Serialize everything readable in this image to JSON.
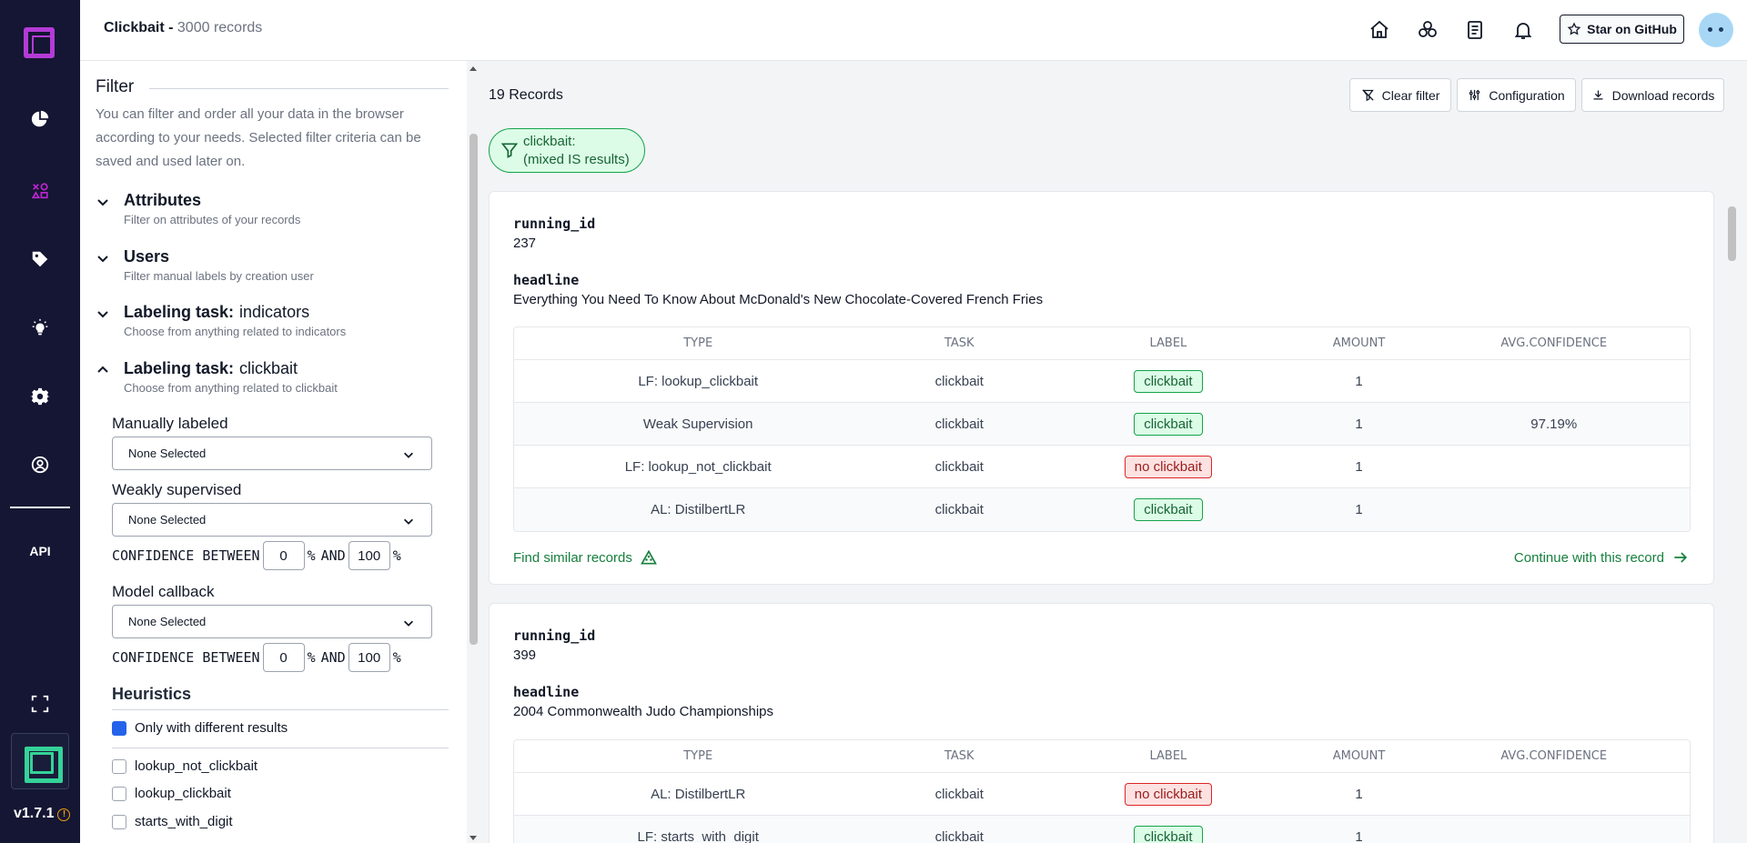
{
  "header": {
    "project": "Clickbait",
    "separator": " - ",
    "record_count": "3000 records",
    "github_label": "Star on GitHub"
  },
  "sidebar": {
    "items": [
      {
        "icon": "overview-pie-icon"
      },
      {
        "icon": "data-browser-icon",
        "active": true
      },
      {
        "icon": "labeling-tag-icon"
      },
      {
        "icon": "heuristics-bulb-icon"
      },
      {
        "icon": "settings-gear-icon"
      },
      {
        "icon": "user-admin-icon"
      }
    ],
    "api_label": "API",
    "version": "v1.7.1",
    "info_glyph": "!"
  },
  "filter": {
    "title": "Filter",
    "description": "You can filter and order all your data in the browser according to your needs. Selected filter criteria can be saved and used later on.",
    "sections": [
      {
        "title": "Attributes",
        "name": "",
        "subtitle": "Filter on attributes of your records",
        "expanded": false
      },
      {
        "title": "Users",
        "name": "",
        "subtitle": "Filter manual labels by creation user",
        "expanded": false
      },
      {
        "title": "Labeling task:",
        "name": "indicators",
        "subtitle": "Choose from anything related to indicators",
        "expanded": false
      },
      {
        "title": "Labeling task:",
        "name": "clickbait",
        "subtitle": "Choose from anything related to clickbait",
        "expanded": true
      }
    ],
    "manually_labeled": {
      "label": "Manually labeled",
      "value": "None Selected"
    },
    "weakly_supervised": {
      "label": "Weakly supervised",
      "value": "None Selected"
    },
    "confidence_1": {
      "prefix": "CONFIDENCE BETWEEN",
      "min": "0",
      "pct1": "%",
      "and": "AND",
      "max": "100",
      "pct2": "%"
    },
    "model_callback": {
      "label": "Model callback",
      "value": "None Selected"
    },
    "confidence_2": {
      "prefix": "CONFIDENCE BETWEEN",
      "min": "0",
      "pct1": "%",
      "and": "AND",
      "max": "100",
      "pct2": "%"
    },
    "heuristics": {
      "title": "Heuristics",
      "only_different": {
        "label": "Only with different results",
        "checked": true
      },
      "items": [
        {
          "label": "lookup_not_clickbait",
          "checked": false
        },
        {
          "label": "lookup_clickbait",
          "checked": false
        },
        {
          "label": "starts_with_digit",
          "checked": false
        }
      ]
    }
  },
  "main": {
    "record_count": "19 Records",
    "buttons": {
      "clear_filter": "Clear filter",
      "configuration": "Configuration",
      "download": "Download records"
    },
    "chip": {
      "line1": "clickbait:",
      "line2": "(mixed IS results)"
    },
    "columns": [
      "TYPE",
      "TASK",
      "LABEL",
      "AMOUNT",
      "AVG.CONFIDENCE"
    ],
    "records": [
      {
        "id_key": "running_id",
        "id_value": "237",
        "text_key": "headline",
        "text_value": "Everything You Need To Know About McDonald's New Chocolate-Covered French Fries",
        "rows": [
          {
            "type": "LF: lookup_clickbait",
            "task": "clickbait",
            "label": "clickbait",
            "label_kind": "positive",
            "amount": "1",
            "confidence": ""
          },
          {
            "type": "Weak Supervision",
            "task": "clickbait",
            "label": "clickbait",
            "label_kind": "positive",
            "amount": "1",
            "confidence": "97.19%"
          },
          {
            "type": "LF: lookup_not_clickbait",
            "task": "clickbait",
            "label": "no clickbait",
            "label_kind": "negative",
            "amount": "1",
            "confidence": ""
          },
          {
            "type": "AL: DistilbertLR",
            "task": "clickbait",
            "label": "clickbait",
            "label_kind": "positive",
            "amount": "1",
            "confidence": ""
          }
        ],
        "find_similar": "Find similar records",
        "continue": "Continue with this record"
      },
      {
        "id_key": "running_id",
        "id_value": "399",
        "text_key": "headline",
        "text_value": "2004 Commonwealth Judo Championships",
        "rows": [
          {
            "type": "AL: DistilbertLR",
            "task": "clickbait",
            "label": "no clickbait",
            "label_kind": "negative",
            "amount": "1",
            "confidence": ""
          },
          {
            "type": "LF: starts_with_digit",
            "task": "clickbait",
            "label": "clickbait",
            "label_kind": "positive",
            "amount": "1",
            "confidence": ""
          }
        ]
      }
    ]
  }
}
